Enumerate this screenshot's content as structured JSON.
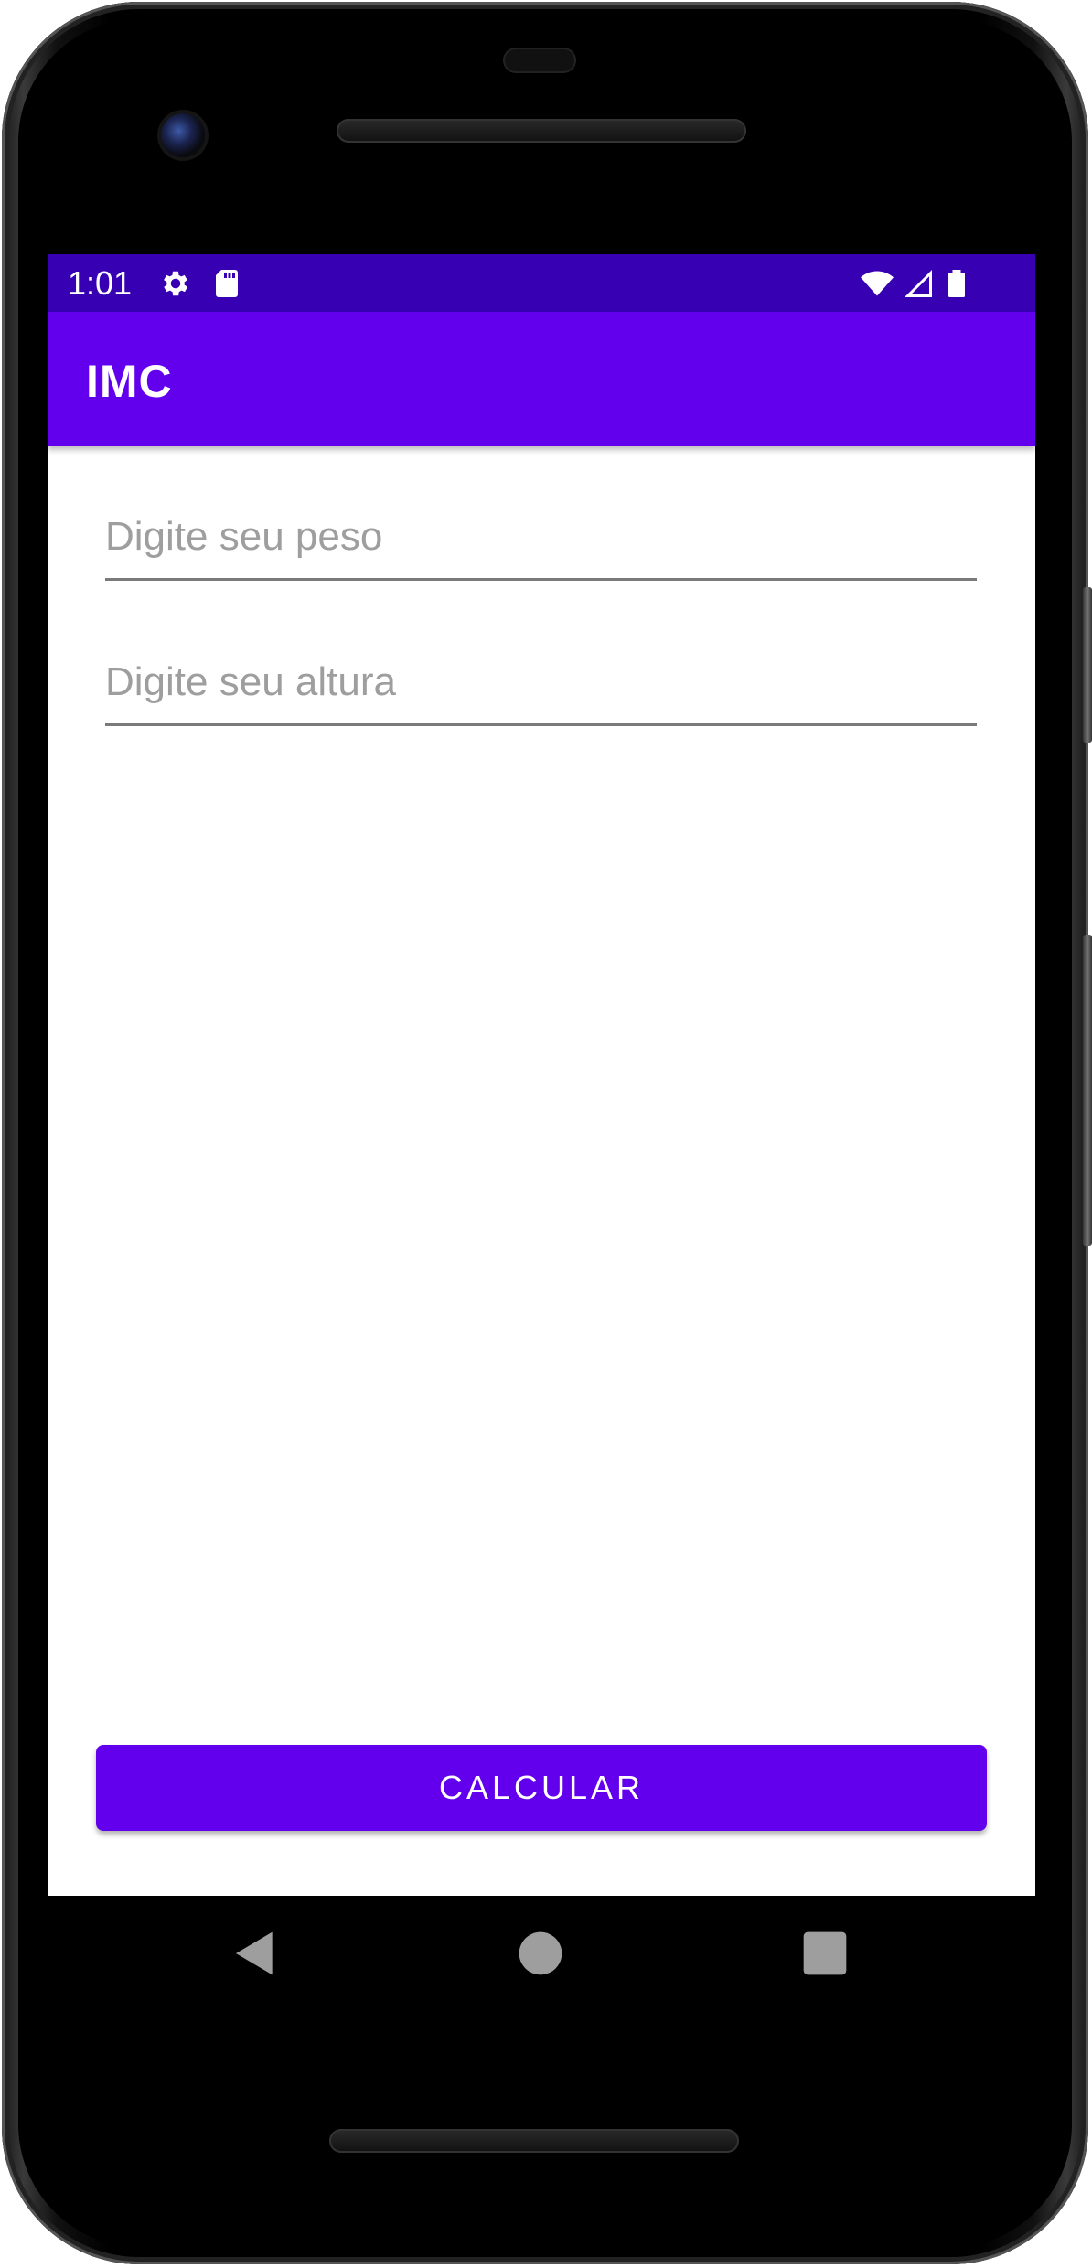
{
  "status_bar": {
    "time": "1:01",
    "icons": [
      "gear-icon",
      "sd-card-icon",
      "wifi-icon",
      "signal-icon",
      "battery-icon"
    ],
    "background": "#3700b3"
  },
  "app_bar": {
    "title": "IMC",
    "background": "#6200ee"
  },
  "form": {
    "peso": {
      "value": "",
      "placeholder": "Digite seu peso"
    },
    "altura": {
      "value": "",
      "placeholder": "Digite seu altura"
    }
  },
  "button": {
    "label": "CALCULAR",
    "background": "#6200ee"
  },
  "nav_bar": {
    "icons": [
      "back-icon",
      "home-icon",
      "recents-icon"
    ]
  }
}
